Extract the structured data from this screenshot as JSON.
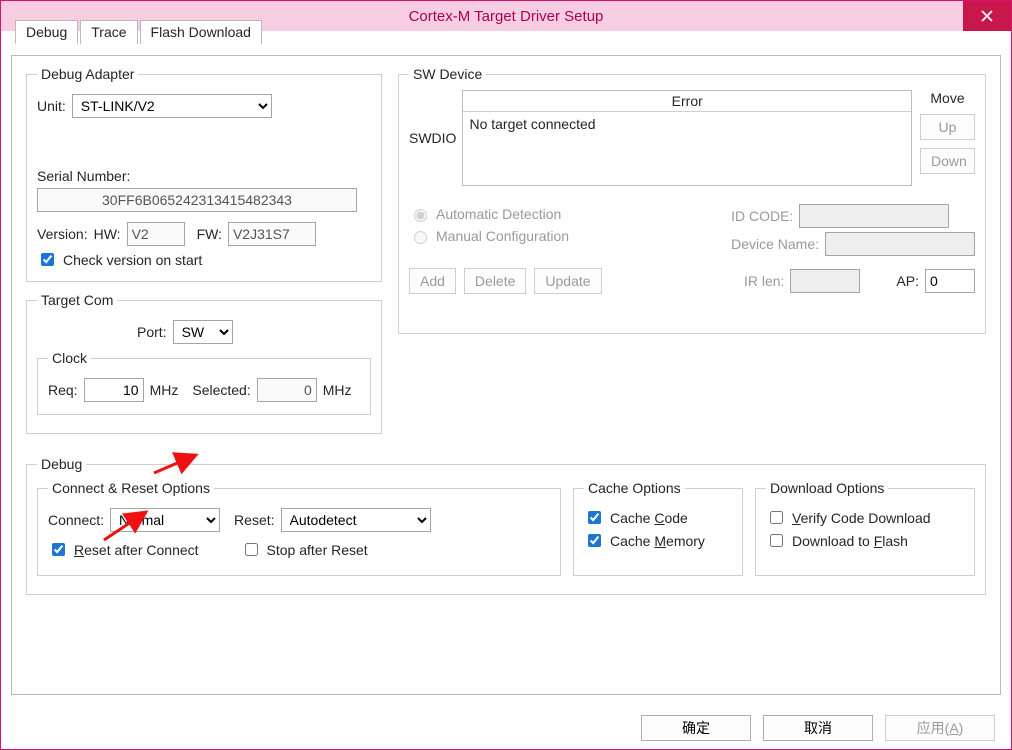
{
  "window": {
    "title": "Cortex-M Target Driver Setup"
  },
  "tabs": [
    "Debug",
    "Trace",
    "Flash Download"
  ],
  "debugAdapter": {
    "legend": "Debug Adapter",
    "unitLabel": "Unit:",
    "unitValue": "ST-LINK/V2",
    "serialLabel": "Serial Number:",
    "serialValue": "30FF6B065242313415482343",
    "versionLabel": "Version:",
    "hwLabel": "HW:",
    "hwValue": "V2",
    "fwLabel": "FW:",
    "fwValue": "V2J31S7",
    "checkVersion": "Check version on start"
  },
  "targetCom": {
    "legend": "Target Com",
    "portLabel": "Port:",
    "portValue": "SW",
    "clockLegend": "Clock",
    "reqLabel": "Req:",
    "reqValue": "10",
    "mhz": "MHz",
    "selectedLabel": "Selected:",
    "selectedValue": "0"
  },
  "swDevice": {
    "legend": "SW Device",
    "swdio": "SWDIO",
    "errorHead": "Error",
    "errorBody": "No target connected",
    "move": "Move",
    "up": "Up",
    "down": "Down",
    "autoDetect": "Automatic Detection",
    "manualConfig": "Manual Configuration",
    "idCode": "ID CODE:",
    "deviceName": "Device Name:",
    "irLen": "IR len:",
    "ap": "AP:",
    "apValue": "0",
    "add": "Add",
    "delete": "Delete",
    "update": "Update"
  },
  "debugSection": {
    "legend": "Debug",
    "connectReset": "Connect & Reset Options",
    "connectLabel": "Connect:",
    "connectValue": "Normal",
    "resetLabel": "Reset:",
    "resetValue": "Autodetect",
    "resetAfter": "Reset after Connect",
    "stopAfter": "Stop after Reset",
    "cacheLegend": "Cache Options",
    "cacheCode": "Cache Code",
    "cacheMemory": "Cache Memory",
    "downloadLegend": "Download Options",
    "verify": "Verify Code Download",
    "dlFlash": "Download to Flash"
  },
  "footer": {
    "ok": "确定",
    "cancel": "取消",
    "apply": "应用(A)"
  }
}
